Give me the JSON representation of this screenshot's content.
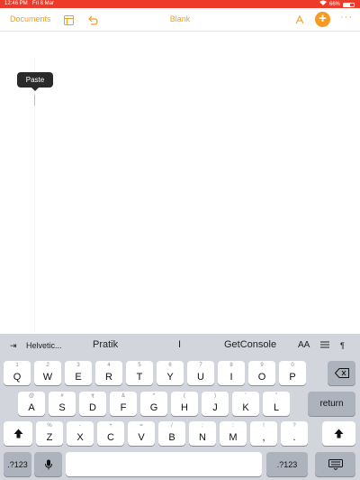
{
  "status_bar": {
    "time": "12:46 PM",
    "date": "Fri 8 Mar",
    "battery": "66%",
    "battery_level": 0.66
  },
  "toolbar": {
    "documents_label": "Documents",
    "title": "Blank",
    "add_symbol": "+",
    "more_symbol": "···"
  },
  "document": {
    "paste_label": "Paste"
  },
  "keyboard": {
    "suggestions": {
      "font": "Helvetic...",
      "words": [
        "Pratik",
        "I",
        "GetConsole"
      ],
      "font_size_label": "AA",
      "paragraph_symbol": "¶"
    },
    "row1": [
      {
        "main": "Q",
        "alt": "1"
      },
      {
        "main": "W",
        "alt": "2"
      },
      {
        "main": "E",
        "alt": "3"
      },
      {
        "main": "R",
        "alt": "4"
      },
      {
        "main": "T",
        "alt": "5"
      },
      {
        "main": "Y",
        "alt": "6"
      },
      {
        "main": "U",
        "alt": "7"
      },
      {
        "main": "I",
        "alt": "8"
      },
      {
        "main": "O",
        "alt": "9"
      },
      {
        "main": "P",
        "alt": "0"
      }
    ],
    "row2": [
      {
        "main": "A",
        "alt": "@"
      },
      {
        "main": "S",
        "alt": "#"
      },
      {
        "main": "D",
        "alt": "₹"
      },
      {
        "main": "F",
        "alt": "&"
      },
      {
        "main": "G",
        "alt": "*"
      },
      {
        "main": "H",
        "alt": "("
      },
      {
        "main": "J",
        "alt": ")"
      },
      {
        "main": "K",
        "alt": "'"
      },
      {
        "main": "L",
        "alt": "\""
      }
    ],
    "row3": [
      {
        "main": "Z",
        "alt": "%"
      },
      {
        "main": "X",
        "alt": "-"
      },
      {
        "main": "C",
        "alt": "+"
      },
      {
        "main": "V",
        "alt": "="
      },
      {
        "main": "B",
        "alt": "/"
      },
      {
        "main": "N",
        "alt": ";"
      },
      {
        "main": "M",
        "alt": ":"
      },
      {
        "main": ",",
        "alt": "!"
      },
      {
        "main": ".",
        "alt": "?"
      }
    ],
    "return_label": "return",
    "numbers_label": ".?123"
  }
}
